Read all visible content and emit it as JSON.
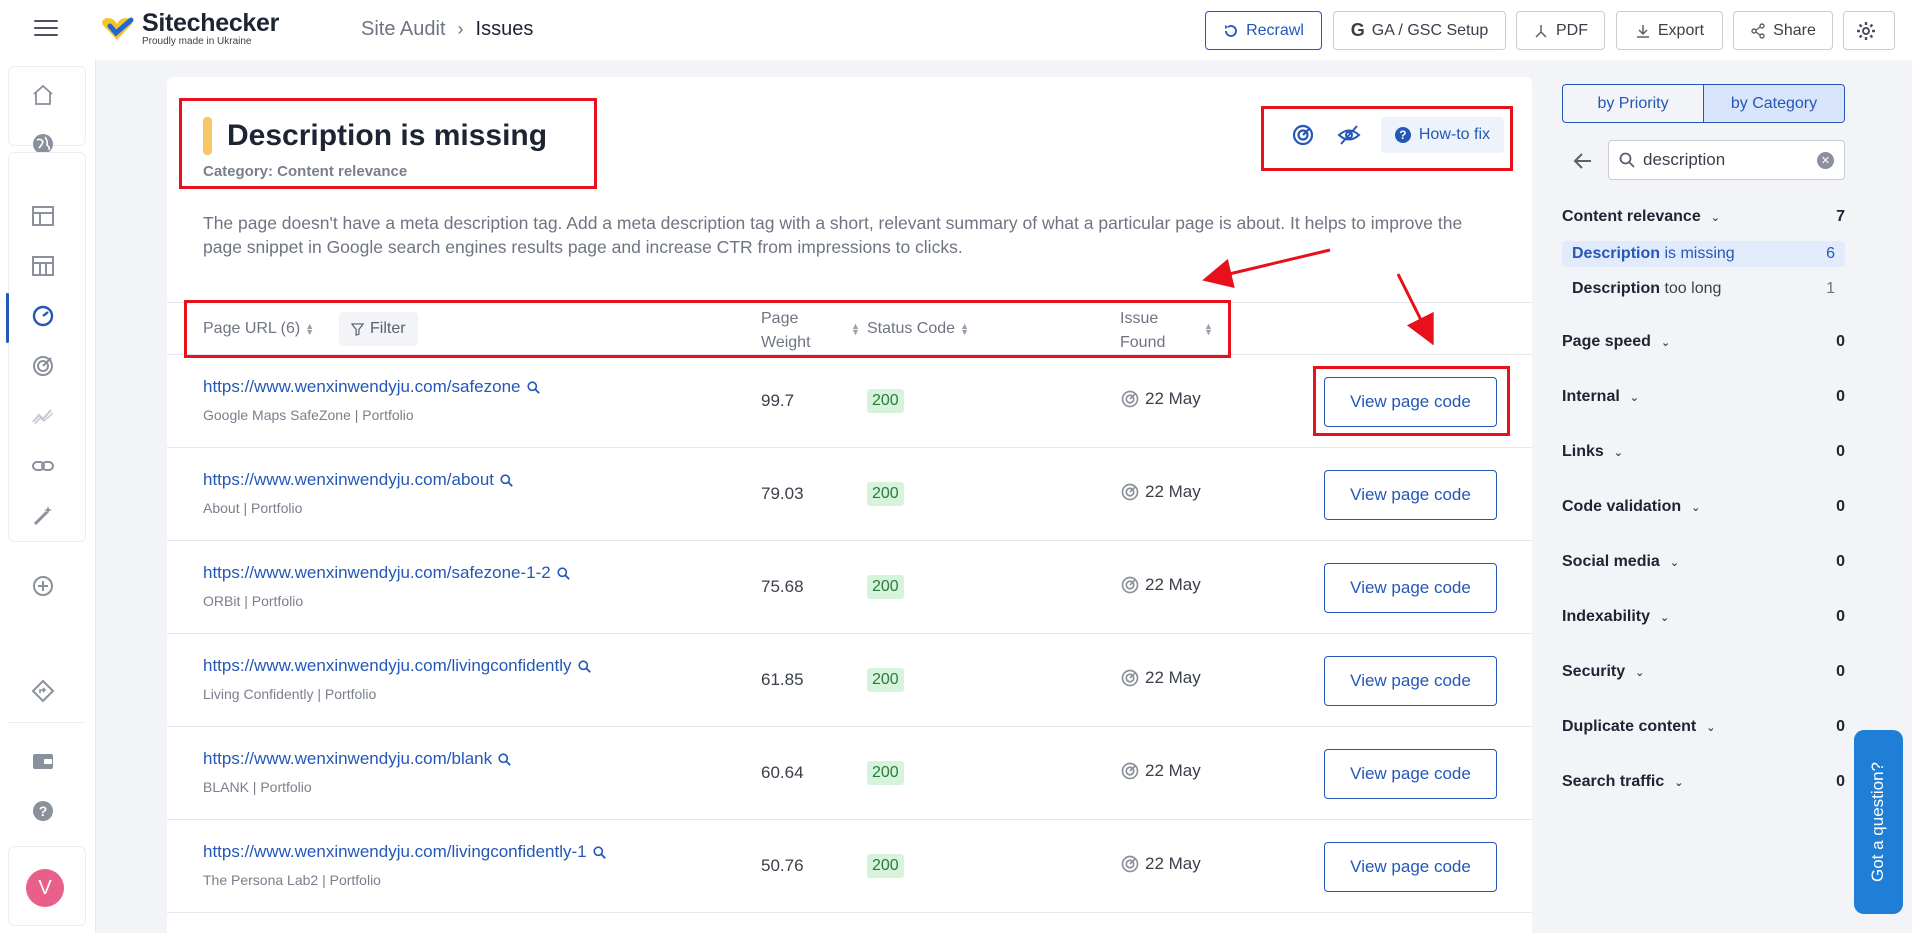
{
  "brand": {
    "name": "Sitechecker",
    "tagline": "Proudly made in Ukraine"
  },
  "breadcrumb": {
    "parent": "Site Audit",
    "current": "Issues"
  },
  "toolbar": {
    "recrawl": "Recrawl",
    "ga_setup": "GA / GSC Setup",
    "pdf": "PDF",
    "export": "Export",
    "share": "Share"
  },
  "issue": {
    "title": "Description is missing",
    "category": "Category: Content relevance",
    "description": "The page doesn't have a meta description tag. Add a meta description tag with a short, relevant summary of what a particular page is about. It helps to improve the page snippet in Google search engines results page and increase CTR from impressions to clicks.",
    "how_to_fix": "How-to fix"
  },
  "table": {
    "col_url": "Page URL (6)",
    "filter": "Filter",
    "col_weight_1": "Page",
    "col_weight_2": "Weight",
    "col_status": "Status Code",
    "col_found_1": "Issue",
    "col_found_2": "Found",
    "action_label": "View page code",
    "rows": [
      {
        "url": "https://www.wenxinwendyju.com/safezone",
        "title": "Google Maps SafeZone | Portfolio",
        "weight": "99.7",
        "status": "200",
        "found": "22 May"
      },
      {
        "url": "https://www.wenxinwendyju.com/about",
        "title": "About | Portfolio",
        "weight": "79.03",
        "status": "200",
        "found": "22 May"
      },
      {
        "url": "https://www.wenxinwendyju.com/safezone-1-2",
        "title": "ORBit | Portfolio",
        "weight": "75.68",
        "status": "200",
        "found": "22 May"
      },
      {
        "url": "https://www.wenxinwendyju.com/livingconfidently",
        "title": "Living Confidently | Portfolio",
        "weight": "61.85",
        "status": "200",
        "found": "22 May"
      },
      {
        "url": "https://www.wenxinwendyju.com/blank",
        "title": "BLANK | Portfolio",
        "weight": "60.64",
        "status": "200",
        "found": "22 May"
      },
      {
        "url": "https://www.wenxinwendyju.com/livingconfidently-1",
        "title": "The Persona Lab2 | Portfolio",
        "weight": "50.76",
        "status": "200",
        "found": "22 May"
      }
    ]
  },
  "panel": {
    "seg_priority": "by Priority",
    "seg_category": "by Category",
    "search_value": "description",
    "categories": [
      {
        "name": "Content relevance",
        "count": "7"
      },
      {
        "name": "Page speed",
        "count": "0"
      },
      {
        "name": "Internal",
        "count": "0"
      },
      {
        "name": "Links",
        "count": "0"
      },
      {
        "name": "Code validation",
        "count": "0"
      },
      {
        "name": "Social media",
        "count": "0"
      },
      {
        "name": "Indexability",
        "count": "0"
      },
      {
        "name": "Security",
        "count": "0"
      },
      {
        "name": "Duplicate content",
        "count": "0"
      },
      {
        "name": "Search traffic",
        "count": "0"
      }
    ],
    "subs": [
      {
        "bold": "Description",
        "rest": " is missing",
        "count": "6"
      },
      {
        "bold": "Description",
        "rest": " too long",
        "count": "1"
      }
    ]
  },
  "user": {
    "initial": "V"
  },
  "help_widget": "Got a question?",
  "colors": {
    "accent": "#2457b6",
    "annotation": "#e8101a",
    "success_bg": "#d6f3dc",
    "title_bar": "#f6c667"
  }
}
